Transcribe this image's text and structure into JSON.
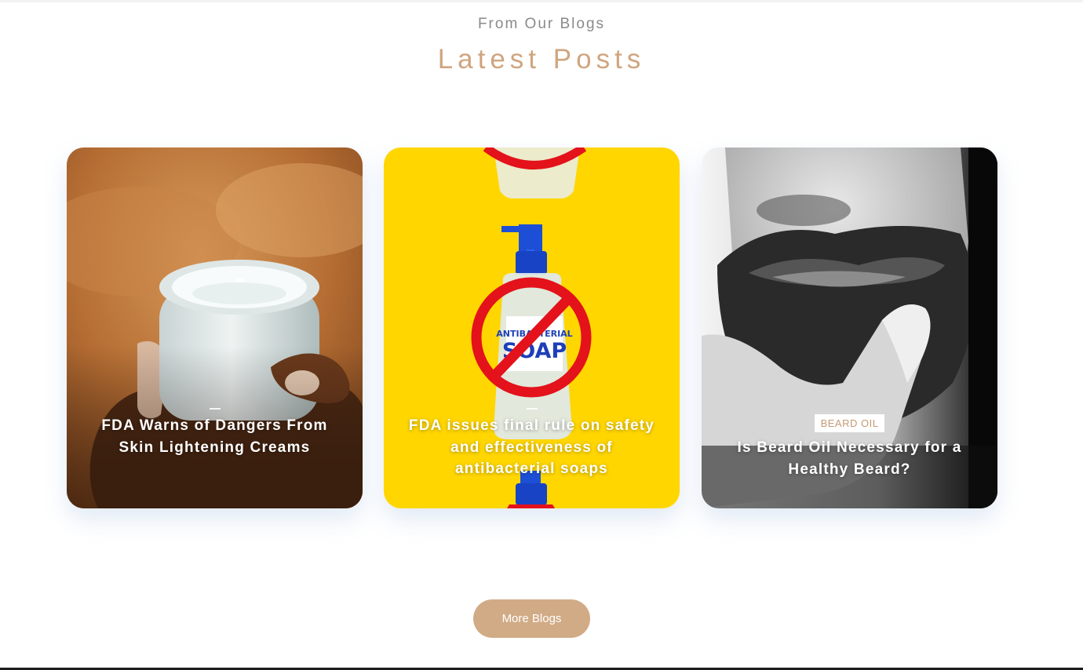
{
  "section": {
    "eyebrow": "From Our Blogs",
    "heading": "Latest Posts"
  },
  "posts": [
    {
      "title": "FDA Warns of Dangers From Skin Lightening Creams",
      "image": "cream-jar-in-hand"
    },
    {
      "title": "FDA issues final rule on safety and effectiveness of antibacterial soaps",
      "image": "antibacterial-soap-prohibited",
      "image_text": [
        "ANTIBACTERIAL",
        "SOAP"
      ]
    },
    {
      "category": "BEARD OIL",
      "title": "Is Beard Oil Necessary for a Healthy Beard?",
      "image": "bearded-man-chin"
    }
  ],
  "more_button": {
    "label": "More Blogs"
  },
  "colors": {
    "accent": "#d1ab86",
    "heading": "#cfa57f",
    "soap_background": "#ffd600"
  }
}
